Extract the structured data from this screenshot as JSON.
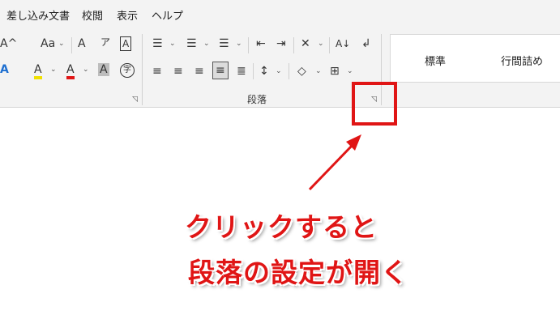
{
  "menu": [
    "差し込み文書",
    "校閲",
    "表示",
    "ヘルプ"
  ],
  "font_group": {
    "row1": [
      "A^",
      "Aa",
      "A",
      "ア",
      "A"
    ],
    "row2": [
      "A",
      "A",
      "A",
      "A",
      "字"
    ]
  },
  "paragraph_group": {
    "label": "段落",
    "row1": [
      "☰",
      "☰",
      "☰",
      "⇤",
      "⇥",
      "✕",
      "A↓",
      "↲"
    ],
    "row2": [
      "≡",
      "≡",
      "≡",
      "≡",
      "≣",
      "↕",
      "◇",
      "⊞"
    ]
  },
  "styles": [
    "標準",
    "行間詰め"
  ],
  "annotation": {
    "line1": "クリックすると",
    "line2": "段落の設定が開く"
  },
  "colors": {
    "accent": "#e01515",
    "ribbon": "#f3f3f3"
  }
}
